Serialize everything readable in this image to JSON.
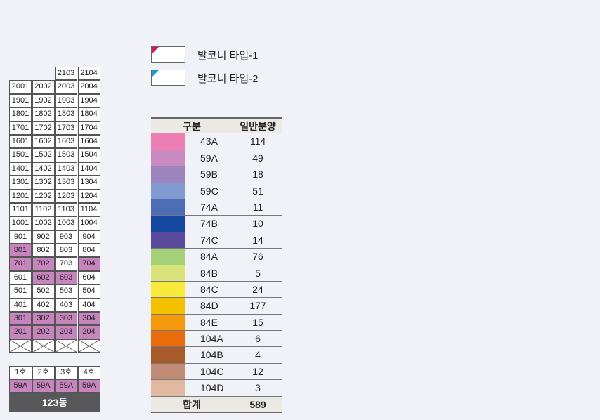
{
  "building": {
    "name": "123동",
    "highlight_color": "#c785bd",
    "floors": [
      {
        "units": [
          "",
          "",
          "2103",
          "2104"
        ],
        "hl": [
          false,
          false,
          false,
          false
        ]
      },
      {
        "units": [
          "2001",
          "2002",
          "2003",
          "2004"
        ],
        "hl": [
          false,
          false,
          false,
          false
        ]
      },
      {
        "units": [
          "1901",
          "1902",
          "1903",
          "1904"
        ],
        "hl": [
          false,
          false,
          false,
          false
        ]
      },
      {
        "units": [
          "1801",
          "1802",
          "1803",
          "1804"
        ],
        "hl": [
          false,
          false,
          false,
          false
        ]
      },
      {
        "units": [
          "1701",
          "1702",
          "1703",
          "1704"
        ],
        "hl": [
          false,
          false,
          false,
          false
        ]
      },
      {
        "units": [
          "1601",
          "1602",
          "1603",
          "1604"
        ],
        "hl": [
          false,
          false,
          false,
          false
        ]
      },
      {
        "units": [
          "1501",
          "1502",
          "1503",
          "1504"
        ],
        "hl": [
          false,
          false,
          false,
          false
        ]
      },
      {
        "units": [
          "1401",
          "1402",
          "1403",
          "1404"
        ],
        "hl": [
          false,
          false,
          false,
          false
        ]
      },
      {
        "units": [
          "1301",
          "1302",
          "1303",
          "1304"
        ],
        "hl": [
          false,
          false,
          false,
          false
        ]
      },
      {
        "units": [
          "1201",
          "1202",
          "1203",
          "1204"
        ],
        "hl": [
          false,
          false,
          false,
          false
        ]
      },
      {
        "units": [
          "1101",
          "1102",
          "1103",
          "1104"
        ],
        "hl": [
          false,
          false,
          false,
          false
        ]
      },
      {
        "units": [
          "1001",
          "1002",
          "1003",
          "1004"
        ],
        "hl": [
          false,
          false,
          false,
          false
        ]
      },
      {
        "units": [
          "901",
          "902",
          "903",
          "904"
        ],
        "hl": [
          false,
          false,
          false,
          false
        ]
      },
      {
        "units": [
          "801",
          "802",
          "803",
          "804"
        ],
        "hl": [
          true,
          false,
          false,
          false
        ]
      },
      {
        "units": [
          "701",
          "702",
          "703",
          "704"
        ],
        "hl": [
          true,
          true,
          false,
          true
        ]
      },
      {
        "units": [
          "601",
          "602",
          "603",
          "604"
        ],
        "hl": [
          false,
          true,
          true,
          false
        ]
      },
      {
        "units": [
          "501",
          "502",
          "503",
          "504"
        ],
        "hl": [
          false,
          false,
          false,
          false
        ]
      },
      {
        "units": [
          "401",
          "402",
          "403",
          "404"
        ],
        "hl": [
          false,
          false,
          false,
          false
        ]
      },
      {
        "units": [
          "301",
          "302",
          "303",
          "304"
        ],
        "hl": [
          true,
          true,
          true,
          true
        ]
      },
      {
        "units": [
          "201",
          "202",
          "203",
          "204"
        ],
        "hl": [
          true,
          true,
          true,
          true
        ]
      },
      {
        "units": [
          "X",
          "X",
          "X",
          "X"
        ],
        "hl": [
          false,
          false,
          false,
          false
        ]
      }
    ],
    "ho_labels": [
      "1호",
      "2호",
      "3호",
      "4호"
    ],
    "type_labels": [
      "59A",
      "59A",
      "59A",
      "59A"
    ]
  },
  "legend": [
    {
      "label": "발코니 타입-1",
      "color": "#d6195b"
    },
    {
      "label": "발코니 타입-2",
      "color": "#1a9ad6"
    }
  ],
  "table": {
    "headers": [
      "구분",
      "일반분양"
    ],
    "rows": [
      {
        "type": "43A",
        "count": "114",
        "color": "#ec7eb4"
      },
      {
        "type": "59A",
        "count": "49",
        "color": "#c98bbf"
      },
      {
        "type": "59B",
        "count": "18",
        "color": "#9c84bf"
      },
      {
        "type": "59C",
        "count": "51",
        "color": "#7f9ad1"
      },
      {
        "type": "74A",
        "count": "11",
        "color": "#4d6db7"
      },
      {
        "type": "74B",
        "count": "10",
        "color": "#1547a0"
      },
      {
        "type": "74C",
        "count": "14",
        "color": "#5a4a9c"
      },
      {
        "type": "84A",
        "count": "76",
        "color": "#a4d07a"
      },
      {
        "type": "84B",
        "count": "5",
        "color": "#d8e47a"
      },
      {
        "type": "84C",
        "count": "24",
        "color": "#f7ea3a"
      },
      {
        "type": "84D",
        "count": "177",
        "color": "#f4c000"
      },
      {
        "type": "84E",
        "count": "15",
        "color": "#f29a0c"
      },
      {
        "type": "104A",
        "count": "6",
        "color": "#ea6c0c"
      },
      {
        "type": "104B",
        "count": "4",
        "color": "#a85a2a"
      },
      {
        "type": "104C",
        "count": "12",
        "color": "#c08c75"
      },
      {
        "type": "104D",
        "count": "3",
        "color": "#e0b9a0"
      }
    ],
    "total_label": "합계",
    "total_value": "589"
  }
}
